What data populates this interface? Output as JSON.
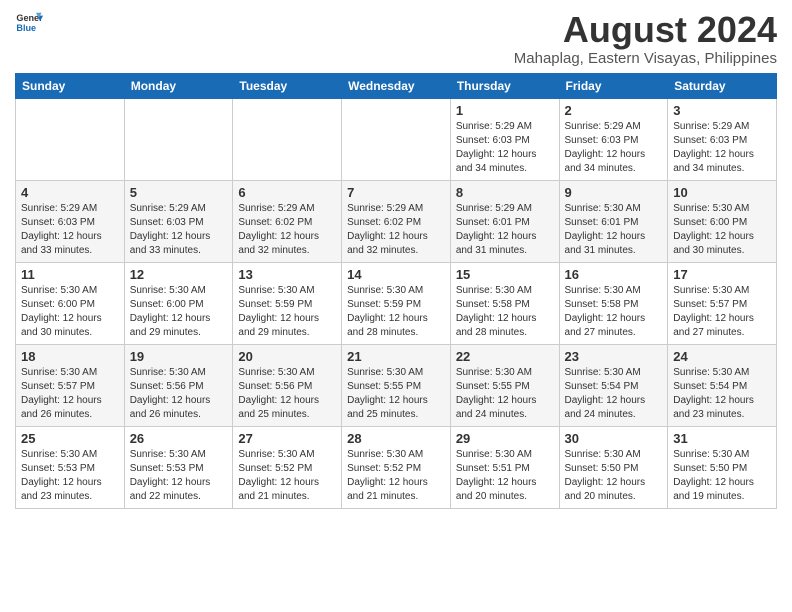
{
  "header": {
    "logo_general": "General",
    "logo_blue": "Blue",
    "title": "August 2024",
    "subtitle": "Mahaplag, Eastern Visayas, Philippines"
  },
  "days_of_week": [
    "Sunday",
    "Monday",
    "Tuesday",
    "Wednesday",
    "Thursday",
    "Friday",
    "Saturday"
  ],
  "weeks": [
    {
      "cells": [
        {
          "date": "",
          "content": ""
        },
        {
          "date": "",
          "content": ""
        },
        {
          "date": "",
          "content": ""
        },
        {
          "date": "",
          "content": ""
        },
        {
          "date": "1",
          "content": "Sunrise: 5:29 AM\nSunset: 6:03 PM\nDaylight: 12 hours and 34 minutes."
        },
        {
          "date": "2",
          "content": "Sunrise: 5:29 AM\nSunset: 6:03 PM\nDaylight: 12 hours and 34 minutes."
        },
        {
          "date": "3",
          "content": "Sunrise: 5:29 AM\nSunset: 6:03 PM\nDaylight: 12 hours and 34 minutes."
        }
      ]
    },
    {
      "cells": [
        {
          "date": "4",
          "content": "Sunrise: 5:29 AM\nSunset: 6:03 PM\nDaylight: 12 hours and 33 minutes."
        },
        {
          "date": "5",
          "content": "Sunrise: 5:29 AM\nSunset: 6:03 PM\nDaylight: 12 hours and 33 minutes."
        },
        {
          "date": "6",
          "content": "Sunrise: 5:29 AM\nSunset: 6:02 PM\nDaylight: 12 hours and 32 minutes."
        },
        {
          "date": "7",
          "content": "Sunrise: 5:29 AM\nSunset: 6:02 PM\nDaylight: 12 hours and 32 minutes."
        },
        {
          "date": "8",
          "content": "Sunrise: 5:29 AM\nSunset: 6:01 PM\nDaylight: 12 hours and 31 minutes."
        },
        {
          "date": "9",
          "content": "Sunrise: 5:30 AM\nSunset: 6:01 PM\nDaylight: 12 hours and 31 minutes."
        },
        {
          "date": "10",
          "content": "Sunrise: 5:30 AM\nSunset: 6:00 PM\nDaylight: 12 hours and 30 minutes."
        }
      ]
    },
    {
      "cells": [
        {
          "date": "11",
          "content": "Sunrise: 5:30 AM\nSunset: 6:00 PM\nDaylight: 12 hours and 30 minutes."
        },
        {
          "date": "12",
          "content": "Sunrise: 5:30 AM\nSunset: 6:00 PM\nDaylight: 12 hours and 29 minutes."
        },
        {
          "date": "13",
          "content": "Sunrise: 5:30 AM\nSunset: 5:59 PM\nDaylight: 12 hours and 29 minutes."
        },
        {
          "date": "14",
          "content": "Sunrise: 5:30 AM\nSunset: 5:59 PM\nDaylight: 12 hours and 28 minutes."
        },
        {
          "date": "15",
          "content": "Sunrise: 5:30 AM\nSunset: 5:58 PM\nDaylight: 12 hours and 28 minutes."
        },
        {
          "date": "16",
          "content": "Sunrise: 5:30 AM\nSunset: 5:58 PM\nDaylight: 12 hours and 27 minutes."
        },
        {
          "date": "17",
          "content": "Sunrise: 5:30 AM\nSunset: 5:57 PM\nDaylight: 12 hours and 27 minutes."
        }
      ]
    },
    {
      "cells": [
        {
          "date": "18",
          "content": "Sunrise: 5:30 AM\nSunset: 5:57 PM\nDaylight: 12 hours and 26 minutes."
        },
        {
          "date": "19",
          "content": "Sunrise: 5:30 AM\nSunset: 5:56 PM\nDaylight: 12 hours and 26 minutes."
        },
        {
          "date": "20",
          "content": "Sunrise: 5:30 AM\nSunset: 5:56 PM\nDaylight: 12 hours and 25 minutes."
        },
        {
          "date": "21",
          "content": "Sunrise: 5:30 AM\nSunset: 5:55 PM\nDaylight: 12 hours and 25 minutes."
        },
        {
          "date": "22",
          "content": "Sunrise: 5:30 AM\nSunset: 5:55 PM\nDaylight: 12 hours and 24 minutes."
        },
        {
          "date": "23",
          "content": "Sunrise: 5:30 AM\nSunset: 5:54 PM\nDaylight: 12 hours and 24 minutes."
        },
        {
          "date": "24",
          "content": "Sunrise: 5:30 AM\nSunset: 5:54 PM\nDaylight: 12 hours and 23 minutes."
        }
      ]
    },
    {
      "cells": [
        {
          "date": "25",
          "content": "Sunrise: 5:30 AM\nSunset: 5:53 PM\nDaylight: 12 hours and 23 minutes."
        },
        {
          "date": "26",
          "content": "Sunrise: 5:30 AM\nSunset: 5:53 PM\nDaylight: 12 hours and 22 minutes."
        },
        {
          "date": "27",
          "content": "Sunrise: 5:30 AM\nSunset: 5:52 PM\nDaylight: 12 hours and 21 minutes."
        },
        {
          "date": "28",
          "content": "Sunrise: 5:30 AM\nSunset: 5:52 PM\nDaylight: 12 hours and 21 minutes."
        },
        {
          "date": "29",
          "content": "Sunrise: 5:30 AM\nSunset: 5:51 PM\nDaylight: 12 hours and 20 minutes."
        },
        {
          "date": "30",
          "content": "Sunrise: 5:30 AM\nSunset: 5:50 PM\nDaylight: 12 hours and 20 minutes."
        },
        {
          "date": "31",
          "content": "Sunrise: 5:30 AM\nSunset: 5:50 PM\nDaylight: 12 hours and 19 minutes."
        }
      ]
    }
  ]
}
